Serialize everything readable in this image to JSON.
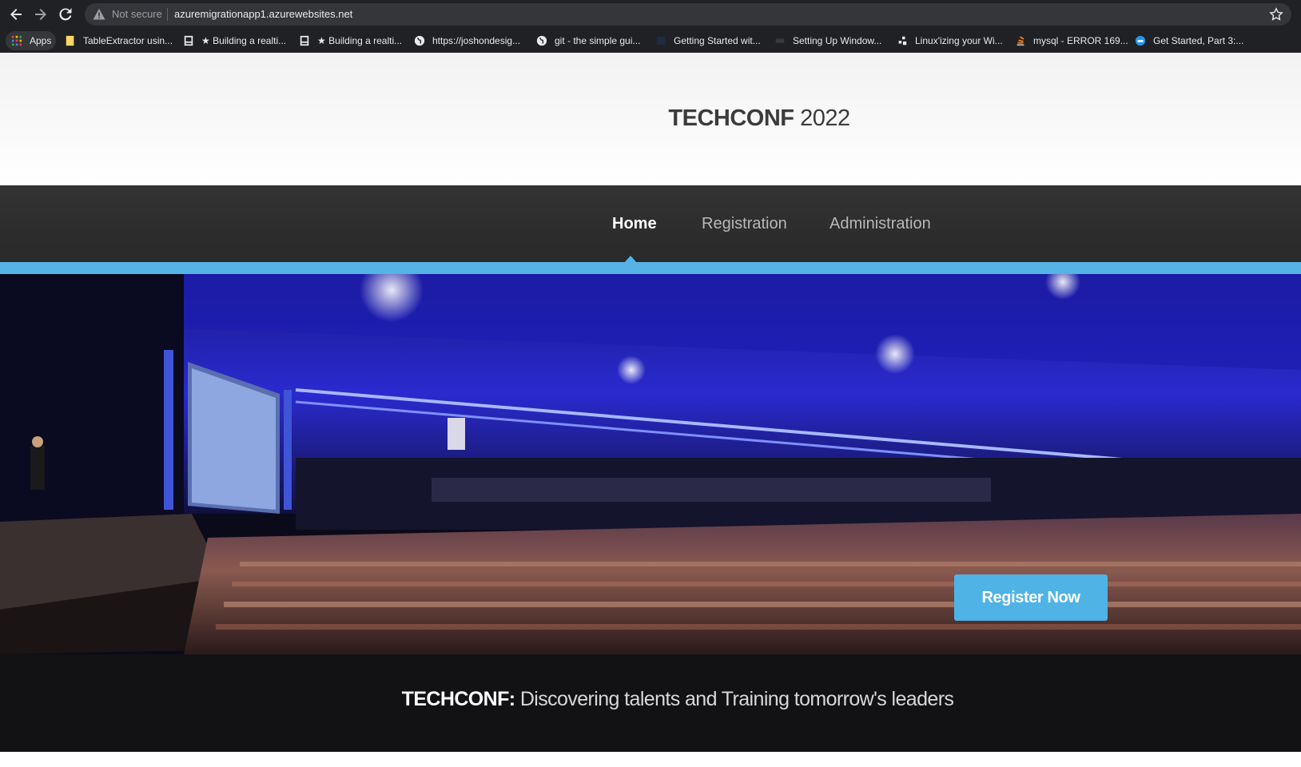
{
  "browser": {
    "security_text": "Not secure",
    "url": "azuremigrationapp1.azurewebsites.net",
    "bookmarks": [
      {
        "label": "Apps",
        "icon": "apps-grid-icon"
      },
      {
        "label": "TableExtractor usin...",
        "icon": "folder-icon"
      },
      {
        "label": "★ Building a realti...",
        "icon": "page-icon"
      },
      {
        "label": "★ Building a realti...",
        "icon": "page-icon"
      },
      {
        "label": "https://joshondesig...",
        "icon": "globe-icon"
      },
      {
        "label": "git - the simple gui...",
        "icon": "globe-icon"
      },
      {
        "label": "Getting Started wit...",
        "icon": "site-icon"
      },
      {
        "label": "Setting Up Window...",
        "icon": "site-icon"
      },
      {
        "label": "Linux'izing your Wi...",
        "icon": "site-icon"
      },
      {
        "label": "mysql - ERROR 169...",
        "icon": "stackoverflow-icon"
      },
      {
        "label": "Get Started, Part 3:...",
        "icon": "docker-icon"
      }
    ]
  },
  "site": {
    "logo_bold": "TECHCONF",
    "logo_year": " 2022",
    "nav": [
      {
        "label": "Home",
        "active": true
      },
      {
        "label": "Registration",
        "active": false
      },
      {
        "label": "Administration",
        "active": false
      }
    ],
    "banner": {
      "tagline_bold": "TECHCONF:",
      "tagline_text": " Discovering talents and Training tomorrow's leaders",
      "cta_label": "Register Now"
    },
    "colors": {
      "accent": "#55b3e6",
      "nav_bg": "#2e2e2e",
      "button": "#4fb3e6"
    }
  }
}
